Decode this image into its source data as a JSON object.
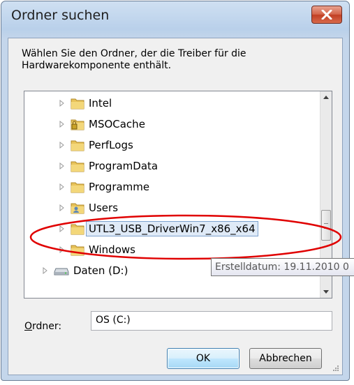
{
  "dialog": {
    "title": "Ordner suchen",
    "description_line1": "Wählen Sie den Ordner, der die Treiber für die",
    "description_line2": "Hardwarekomponente enthält."
  },
  "tree": {
    "items": [
      {
        "label": "Intel",
        "icon": "folder-icon"
      },
      {
        "label": "MSOCache",
        "icon": "locked-folder-icon"
      },
      {
        "label": "PerfLogs",
        "icon": "folder-icon"
      },
      {
        "label": "ProgramData",
        "icon": "folder-icon"
      },
      {
        "label": "Programme",
        "icon": "folder-icon"
      },
      {
        "label": "Users",
        "icon": "users-folder-icon"
      },
      {
        "label": "UTL3_USB_DriverWin7_x86_x64",
        "icon": "folder-icon",
        "selected": true
      },
      {
        "label": "Windows",
        "icon": "folder-icon"
      },
      {
        "label": "Daten (D:)",
        "icon": "drive-icon"
      }
    ]
  },
  "tooltip": "Erstelldatum: 19.11.2010 0",
  "folder_field": {
    "label_underlined": "O",
    "label_rest": "rdner:",
    "value": "OS (C:)"
  },
  "buttons": {
    "ok": "OK",
    "cancel": "Abbrechen"
  },
  "colors": {
    "highlight_ellipse": "#e00000",
    "close_button": "#c9452b",
    "folder": "#e8c35a"
  }
}
